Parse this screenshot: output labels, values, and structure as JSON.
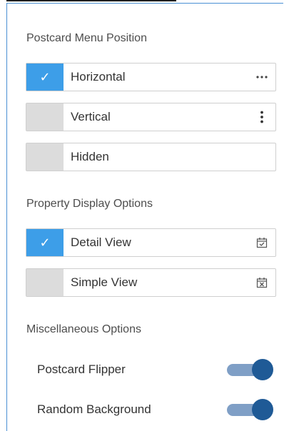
{
  "sections": {
    "menu_position": {
      "title": "Postcard Menu Position",
      "options": [
        {
          "label": "Horizontal",
          "selected": true,
          "icon": "horizontal-dots-icon"
        },
        {
          "label": "Vertical",
          "selected": false,
          "icon": "vertical-dots-icon"
        },
        {
          "label": "Hidden",
          "selected": false,
          "icon": ""
        }
      ]
    },
    "display_options": {
      "title": "Property Display Options",
      "options": [
        {
          "label": "Detail View",
          "selected": true,
          "icon": "calendar-check-icon"
        },
        {
          "label": "Simple View",
          "selected": false,
          "icon": "calendar-x-icon"
        }
      ]
    },
    "misc": {
      "title": "Miscellaneous Options",
      "toggles": [
        {
          "label": "Postcard Flipper",
          "on": true
        },
        {
          "label": "Random Background",
          "on": true
        }
      ]
    }
  },
  "colors": {
    "accent": "#3d9ee8",
    "toggle_knob": "#1f5a96",
    "toggle_track": "#7f9fc6"
  },
  "check_glyph": "✓"
}
